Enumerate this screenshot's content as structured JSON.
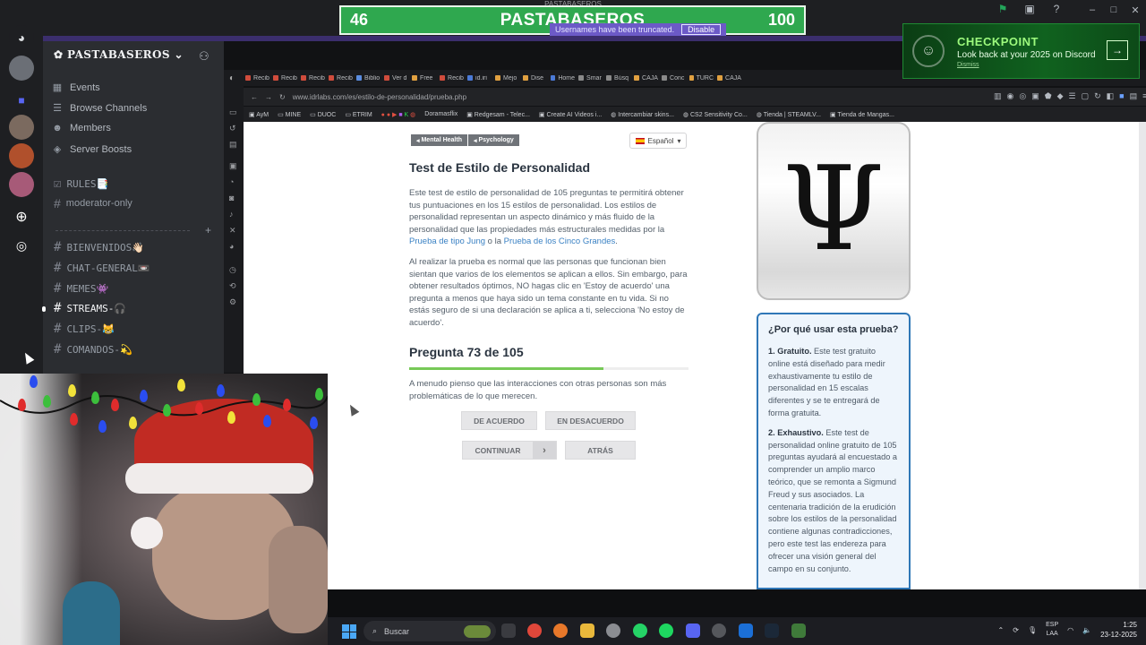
{
  "window": {
    "top_indicator": "PASTABASEROS",
    "controls": [
      "–",
      "□",
      "✕"
    ]
  },
  "overlay": {
    "left_number": "46",
    "title": "PASTABASEROS",
    "right_number": "100",
    "notice": "Usernames have been truncated.",
    "disable_label": "Disable"
  },
  "discord": {
    "server_name": "PASTABASEROS",
    "nav": [
      {
        "label": "Events",
        "icon": "calendar-icon"
      },
      {
        "label": "Browse Channels",
        "icon": "browse-icon"
      },
      {
        "label": "Members",
        "icon": "members-icon"
      },
      {
        "label": "Server Boosts",
        "icon": "boost-icon"
      }
    ],
    "top_channels": [
      {
        "label": "RULES📑",
        "icon": "checkbox-icon"
      },
      {
        "label": "moderator-only",
        "icon": "hash-icon"
      }
    ],
    "channels": [
      {
        "label": "BIENVENIDOS👋🏻",
        "active": false
      },
      {
        "label": "CHAT-GENERAL📼",
        "active": false
      },
      {
        "label": "MEMES👾",
        "active": false
      },
      {
        "label": "STREAMS-🎧",
        "active": true
      },
      {
        "label": "CLIPS-😹",
        "active": false
      },
      {
        "label": "COMANDOS-💫",
        "active": false
      }
    ]
  },
  "checkpoint": {
    "title": "CHECKPOINT",
    "subtitle": "Look back at your 2025 on Discord",
    "dismiss": "Dismiss"
  },
  "browser": {
    "tabs": [
      "Recib",
      "Recib",
      "Recib",
      "Recib",
      "Biblio",
      "Ver d",
      "Free",
      "Recib",
      "id.iri",
      "Mejo",
      "Dise",
      "Home",
      "Smar",
      "Búsq",
      "CAJA",
      "Conc",
      "TURC",
      "CAJA"
    ],
    "url": "www.idrlabs.com/es/estilo-de-personalidad/prueba.php",
    "bookmarks": [
      "AyM",
      "MINE",
      "DUOC",
      "ETRIM",
      "Doramasflix",
      "Redgesam - Telec...",
      "Create AI Videos i...",
      "Intercambiar skins...",
      "CS2 Sensitivity Co...",
      "Tienda | STEAMLV...",
      "Tienda de Mangas..."
    ]
  },
  "page": {
    "tags": [
      "Mental Health",
      "Psychology"
    ],
    "language": "Español",
    "title": "Test de Estilo de Personalidad",
    "intro_a": "Este test de estilo de personalidad de 105 preguntas te permitirá obtener tus puntuaciones en los 15 estilos de personalidad. Los estilos de personalidad representan un aspecto dinámico y más fluido de la personalidad que las propiedades más estructurales medidas por la ",
    "intro_link1": "Prueba de tipo Jung",
    "intro_mid": " o la ",
    "intro_link2": "Prueba de los Cinco Grandes",
    "intro_end": ".",
    "intro2": "Al realizar la prueba es normal que las personas que funcionan bien sientan que varios de los elementos se aplican a ellos. Sin embargo, para obtener resultados óptimos, NO hagas clic en 'Estoy de acuerdo' una pregunta a menos que haya sido un tema constante en tu vida. Si no estás seguro de si una declaración se aplica a ti, selecciona 'No estoy de acuerdo'.",
    "question_label": "Pregunta 73 de 105",
    "progress": 0.695,
    "question": "A menudo pienso que las interacciones con otras personas son más problemáticas de lo que merecen.",
    "btn_agree": "DE ACUERDO",
    "btn_disagree": "EN DESACUERDO",
    "btn_continue": "CONTINUAR",
    "btn_back": "ATRÁS",
    "psi": "Ψ",
    "why_title": "¿Por qué usar esta prueba?",
    "why1_head": "1. Gratuito.",
    "why1_body": " Este test gratuito online está diseñado para medir exhaustivamente tu estilo de personalidad en 15 escalas diferentes y se te entregará de forma gratuita.",
    "why2_head": "2. Exhaustivo.",
    "why2_body": " Este test de personalidad online gratuito de 105 preguntas ayudará al encuestado a comprender un amplio marco teórico, que se remonta a Sigmund Freud y sus asociados. La centenaria tradición de la erudición sobre los estilos de la personalidad contiene algunas contradicciones, pero este test las endereza para ofrecer una visión general del campo en su conjunto."
  },
  "taskbar": {
    "search_placeholder": "Buscar",
    "lang_top": "ESP",
    "lang_bottom": "LAA",
    "time": "1:25",
    "date": "23-12-2025"
  }
}
